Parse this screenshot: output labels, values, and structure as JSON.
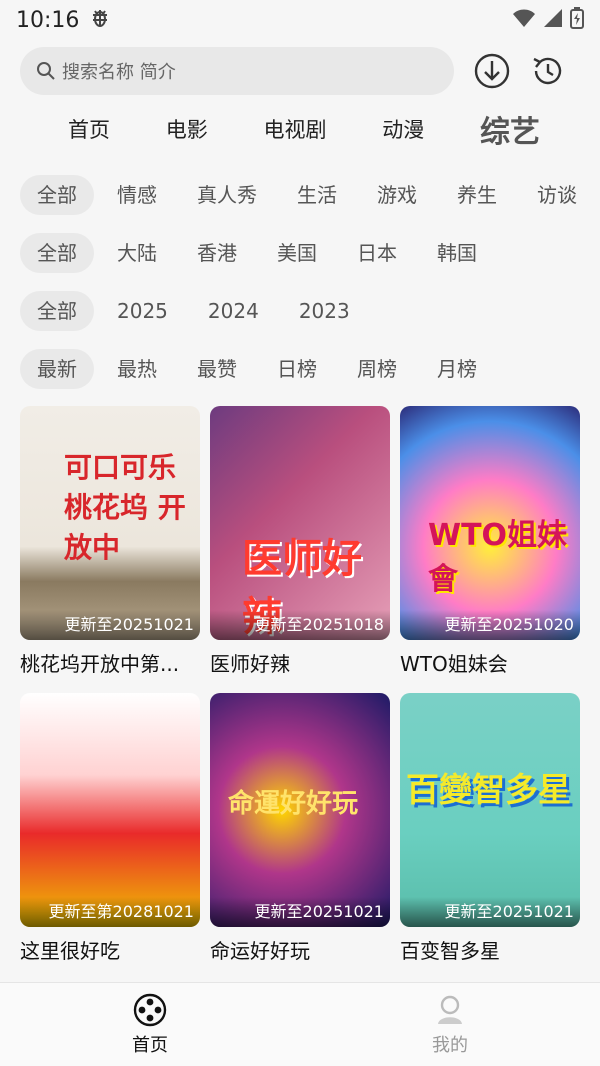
{
  "status": {
    "time": "10:16",
    "notify_icon": "bug-icon",
    "icons": [
      "wifi-icon",
      "signal-icon",
      "battery-icon"
    ]
  },
  "search": {
    "placeholder": "搜索名称 简介",
    "buttons": [
      "download-icon",
      "history-icon"
    ]
  },
  "tabs": [
    {
      "label": "首页",
      "active": false
    },
    {
      "label": "电影",
      "active": false
    },
    {
      "label": "电视剧",
      "active": false
    },
    {
      "label": "动漫",
      "active": false
    },
    {
      "label": "综艺",
      "active": true
    }
  ],
  "filters": {
    "genre": [
      "全部",
      "情感",
      "真人秀",
      "生活",
      "游戏",
      "养生",
      "访谈"
    ],
    "region": [
      "全部",
      "大陆",
      "香港",
      "美国",
      "日本",
      "韩国"
    ],
    "year": [
      "全部",
      "2025",
      "2024",
      "2023"
    ],
    "sort": [
      "最新",
      "最热",
      "最赞",
      "日榜",
      "周榜",
      "月榜"
    ]
  },
  "cards": [
    {
      "title": "桃花坞开放中第...",
      "badge": "更新至20251021",
      "art": "可口可乐 桃花坞 开放中"
    },
    {
      "title": "医师好辣",
      "badge": "更新至20251018",
      "art": "医师好辣"
    },
    {
      "title": "WTO姐妹会",
      "badge": "更新至20251020",
      "art": "WTO姐妹會"
    },
    {
      "title": "这里很好吃",
      "badge": "更新至第20281021",
      "art": ""
    },
    {
      "title": "命运好好玩",
      "badge": "更新至20251021",
      "art": "命運好好玩"
    },
    {
      "title": "百变智多星",
      "badge": "更新至20251021",
      "art": "百變智多星"
    }
  ],
  "bottom_nav": [
    {
      "label": "首页",
      "icon": "film-reel-icon",
      "active": true
    },
    {
      "label": "我的",
      "icon": "user-icon",
      "active": false
    }
  ]
}
